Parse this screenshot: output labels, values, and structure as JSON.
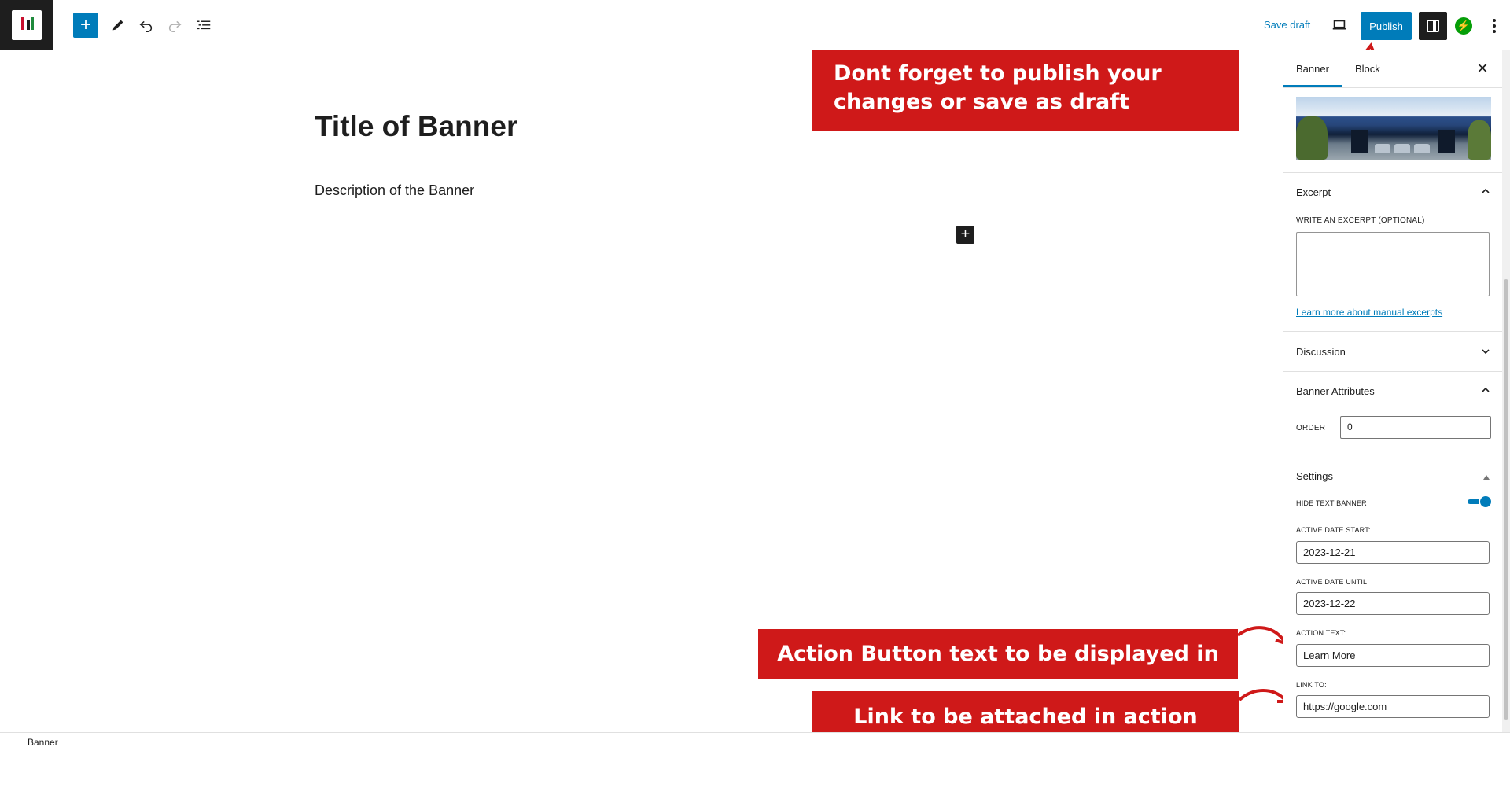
{
  "toolbar": {
    "add_block_icon": "plus-icon",
    "save_draft_label": "Save draft",
    "publish_label": "Publish"
  },
  "editor": {
    "title": "Title of Banner",
    "description": "Description of the Banner"
  },
  "annotations": {
    "publish_note": "Dont forget to publish your changes or save as draft",
    "action_note": "Action Button text to be displayed in banner",
    "link_note": "Link to be attached in action button",
    "color": "#cf1919"
  },
  "sidebar": {
    "tabs": [
      {
        "label": "Banner",
        "active": true
      },
      {
        "label": "Block",
        "active": false
      }
    ],
    "excerpt": {
      "heading": "Excerpt",
      "field_label": "WRITE AN EXCERPT (OPTIONAL)",
      "value": "",
      "link": "Learn more about manual excerpts"
    },
    "discussion": {
      "heading": "Discussion"
    },
    "attributes": {
      "heading": "Banner Attributes",
      "order_label": "ORDER",
      "order_value": "0"
    },
    "settings": {
      "heading": "Settings",
      "hide_text_label": "HIDE TEXT BANNER",
      "hide_text_on": true,
      "date_start_label": "ACTIVE DATE START:",
      "date_start": "2023-12-21",
      "date_until_label": "ACTIVE DATE UNTIL:",
      "date_until": "2023-12-22",
      "action_text_label": "ACTION TEXT:",
      "action_text": "Learn More",
      "link_label": "LINK TO:",
      "link_value": "https://google.com"
    }
  },
  "footer": {
    "breadcrumb": "Banner"
  },
  "colors": {
    "accent": "#007cba",
    "dark": "#1e1e1e",
    "jetpack": "#069e08"
  }
}
